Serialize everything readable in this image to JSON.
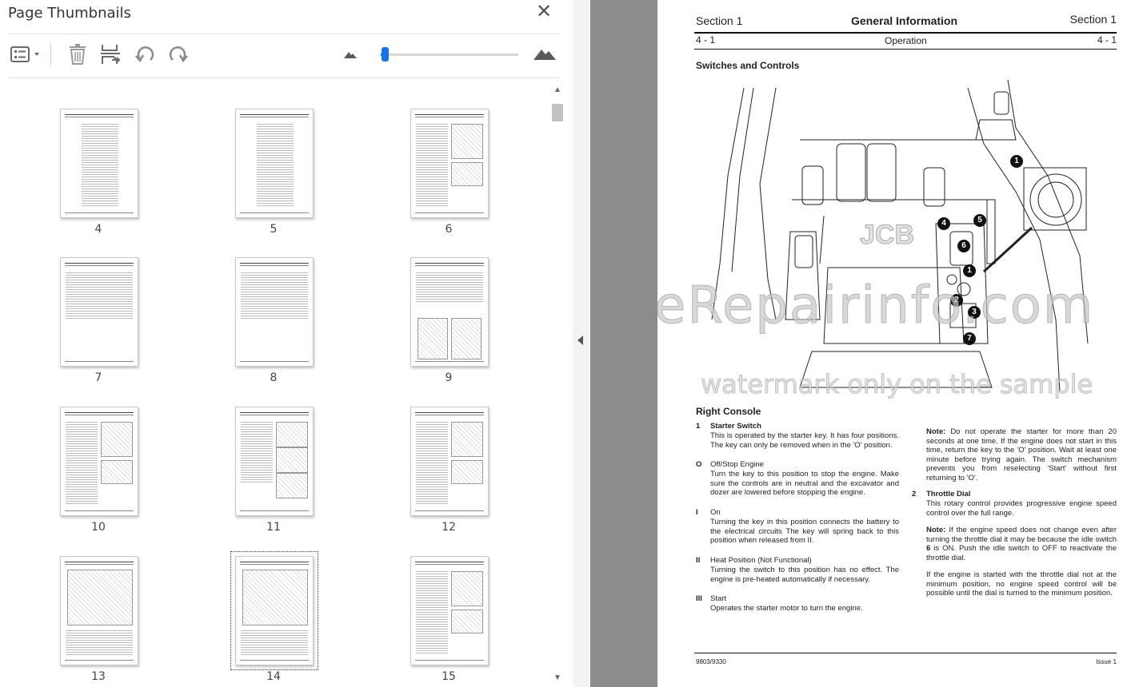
{
  "panel": {
    "title": "Page Thumbnails",
    "close_icon": "close-icon",
    "toolbar": {
      "options_icon": "thumbnail-options-icon",
      "delete_icon": "trash-icon",
      "insert_icon": "insert-pages-icon",
      "rotate_ccw_icon": "rotate-counterclockwise-icon",
      "rotate_cw_icon": "rotate-clockwise-icon",
      "zoom_out_icon": "mountain-small-icon",
      "zoom_in_icon": "mountain-large-icon",
      "zoom_level": 0.03
    },
    "thumbnails": [
      {
        "page": "4"
      },
      {
        "page": "5"
      },
      {
        "page": "6"
      },
      {
        "page": "7"
      },
      {
        "page": "8"
      },
      {
        "page": "9"
      },
      {
        "page": "10"
      },
      {
        "page": "11"
      },
      {
        "page": "12"
      },
      {
        "page": "13"
      },
      {
        "page": "14"
      },
      {
        "page": "15"
      }
    ],
    "selected_page": "14"
  },
  "accent_color": "#1473e6",
  "document": {
    "header": {
      "section_left": "Section 1",
      "title": "General Information",
      "section_right": "Section 1",
      "page_left": "4 - 1",
      "subtitle": "Operation",
      "page_right": "4 - 1"
    },
    "section_title": "Switches and Controls",
    "subsection_title": "Right Console",
    "callouts": [
      "1",
      "4",
      "5",
      "6",
      "1",
      "2",
      "3",
      "7"
    ],
    "illustration_text": "JCB",
    "items_left": [
      {
        "num": "1",
        "title": "Starter Switch",
        "text": "This is operated by the starter key. It has four positions. The key can only be removed when in the 'O' position."
      },
      {
        "num": "O",
        "title": "Off/Stop Engine",
        "text": "Turn the key to this position to stop the engine. Make sure the controls are in neutral and the excavator and dozer are lowered before stopping the engine."
      },
      {
        "num": "I",
        "title": "On",
        "text": "Turning the key in this position connects the battery to the electrical circuits The key will spring back to this position when released from II."
      },
      {
        "num": "II",
        "title": "Heat Position (Not Functional)",
        "text": "Turning the switch to this position has no effect. The engine is pre-heated automatically if necessary."
      },
      {
        "num": "III",
        "title": "Start",
        "text": "Operates the starter motor to turn the engine."
      }
    ],
    "note1_label": "Note:",
    "note1_text": "Do not operate the starter for more than 20 seconds at one time. If the engine does not start in this time, return the key to the 'O' position. Wait at least one minute before trying again. The switch mechanism prevents you from reselecting 'Start' without first returning to 'O'.",
    "item2_num": "2",
    "item2_title": "Throttle Dial",
    "item2_text": "This rotary control provides progressive engine speed control over the full range.",
    "note2_label": "Note:",
    "note2_text_a": "If the engine speed does not change even after turning the throttle dial it may be because the idle switch",
    "note2_bold": "6",
    "note2_text_b": "is ON. Push the idle switch to OFF to reactivate the throttle dial.",
    "para_final": "If the engine is started with the throttle dial not at the minimum position, no engine speed control will be possible until the dial is turned to the minimum position.",
    "footer_left": "9803/9330",
    "footer_right": "Issue 1",
    "watermark_main": "eRepairinfo.com",
    "watermark_sub": "watermark only on the sample"
  }
}
